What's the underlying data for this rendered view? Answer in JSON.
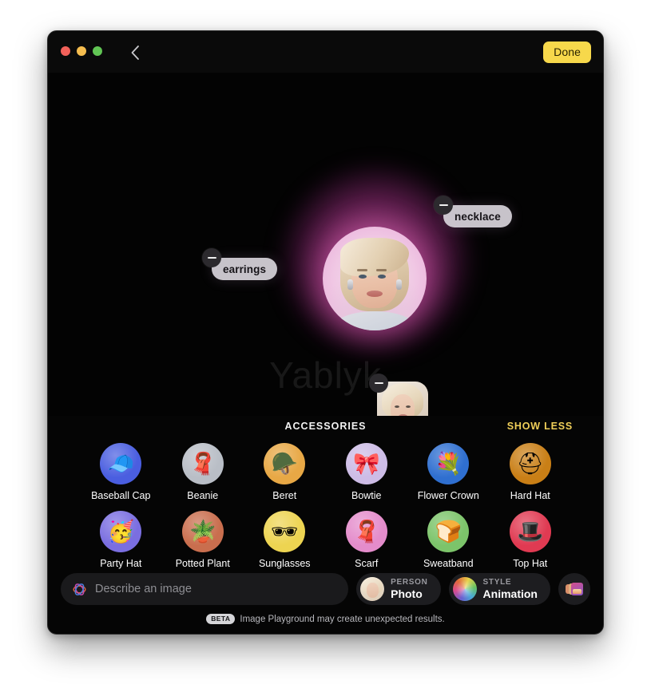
{
  "window": {
    "traffic_lights": [
      "close",
      "minimize",
      "zoom"
    ],
    "back_label": "back-chevron",
    "done_label": "Done"
  },
  "canvas": {
    "watermark": "Yablyk",
    "tags": [
      {
        "label": "earrings",
        "remove_label": "remove"
      },
      {
        "label": "necklace",
        "remove_label": "remove"
      }
    ],
    "source_thumbnail": {
      "alt": "source person photo",
      "remove_label": "remove"
    }
  },
  "accessories": {
    "title": "ACCESSORIES",
    "show_less_label": "SHOW LESS",
    "items": [
      {
        "label": "Baseball Cap",
        "glyph": "🧢",
        "bg": "#4a5ee0",
        "icon_name": "baseball-cap-icon"
      },
      {
        "label": "Beanie",
        "glyph": "🧣",
        "bg": "#b9bec6",
        "icon_name": "beanie-icon"
      },
      {
        "label": "Beret",
        "glyph": "🪖",
        "bg": "#e8a845",
        "icon_name": "beret-icon"
      },
      {
        "label": "Bowtie",
        "glyph": "🎀",
        "bg": "#cdbce6",
        "icon_name": "bowtie-icon"
      },
      {
        "label": "Flower Crown",
        "glyph": "💐",
        "bg": "#2f6fd0",
        "icon_name": "flower-crown-icon"
      },
      {
        "label": "Hard Hat",
        "glyph": "⛑",
        "bg": "#c97f16",
        "icon_name": "hard-hat-icon"
      },
      {
        "label": "Party Hat",
        "glyph": "🥳",
        "bg": "#7a6ee0",
        "icon_name": "party-hat-icon"
      },
      {
        "label": "Potted Plant",
        "glyph": "🪴",
        "bg": "#c96e4e",
        "icon_name": "potted-plant-icon"
      },
      {
        "label": "Sunglasses",
        "glyph": "🕶",
        "bg": "#edd451",
        "icon_name": "sunglasses-icon"
      },
      {
        "label": "Scarf",
        "glyph": "🧣",
        "bg": "#e48ccb",
        "icon_name": "scarf-icon"
      },
      {
        "label": "Sweatband",
        "glyph": "🍞",
        "bg": "#7cc46a",
        "icon_name": "sweatband-icon"
      },
      {
        "label": "Top Hat",
        "glyph": "🎩",
        "bg": "#e03a52",
        "icon_name": "top-hat-icon"
      }
    ]
  },
  "bottom_bar": {
    "describe_placeholder": "Describe an image",
    "describe_value": "",
    "person_kicker": "PERSON",
    "person_value": "Photo",
    "style_kicker": "STYLE",
    "style_value": "Animation",
    "photo_library_label": "photo library"
  },
  "footer": {
    "badge": "BETA",
    "text": "Image Playground may create unexpected results."
  },
  "colors": {
    "accent_yellow": "#f7d84b",
    "show_less_yellow": "#f0cf59",
    "window_bg": "#050505",
    "glow_pink": "#ff78d2"
  }
}
